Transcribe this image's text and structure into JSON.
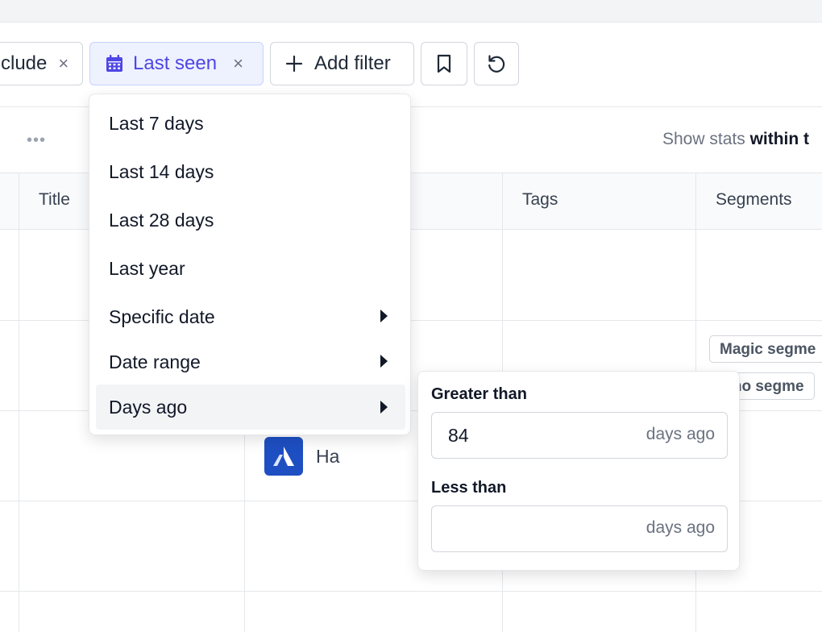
{
  "filters": {
    "include_chip": {
      "label": "clude"
    },
    "last_seen_chip": {
      "label": "Last seen"
    },
    "add_filter": {
      "label": "Add filter"
    }
  },
  "toolbar": {
    "stats_prefix": "Show stats",
    "stats_bold": "within t"
  },
  "table": {
    "headers": {
      "title": "Title",
      "tags": "Tags",
      "segments": "Segments"
    },
    "segment_badges": [
      "Magic segme",
      "emo segme"
    ],
    "company_name": "Ha"
  },
  "dropdown": {
    "items": [
      {
        "label": "Last 7 days"
      },
      {
        "label": "Last 14 days"
      },
      {
        "label": "Last 28 days"
      },
      {
        "label": "Last year"
      },
      {
        "label": "Specific date"
      },
      {
        "label": "Date range"
      },
      {
        "label": "Days ago"
      }
    ]
  },
  "days_ago": {
    "greater_label": "Greater than",
    "greater_value": "84",
    "less_label": "Less than",
    "less_value": "",
    "suffix": "days ago"
  },
  "colors": {
    "accent": "#4f46e5",
    "accent_bg": "#eef2ff",
    "logo_bg": "#1e4fc2"
  }
}
